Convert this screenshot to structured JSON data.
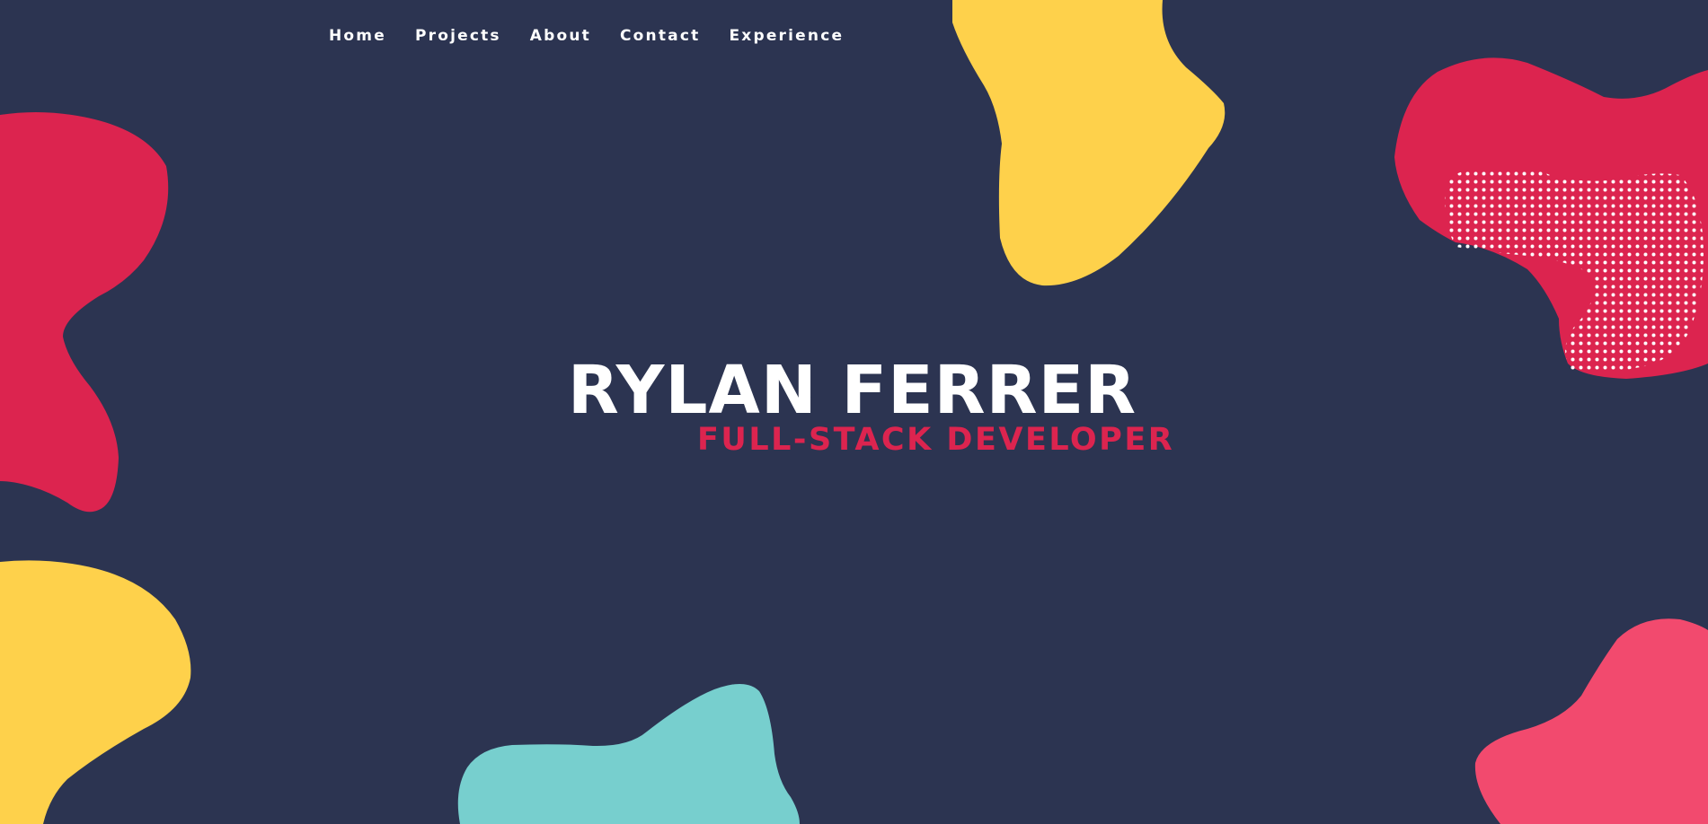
{
  "nav": {
    "items": [
      {
        "label": "Home"
      },
      {
        "label": "Projects"
      },
      {
        "label": "About"
      },
      {
        "label": "Contact"
      },
      {
        "label": "Experience"
      }
    ]
  },
  "hero": {
    "name": "RYLAN FERRER",
    "role": "FULL-STACK DEVELOPER"
  },
  "colors": {
    "background": "#2c3451",
    "red": "#dc244f",
    "yellow": "#fed14b",
    "teal": "#77cfce",
    "pink": "#f24a6e",
    "white": "#ffffff"
  }
}
